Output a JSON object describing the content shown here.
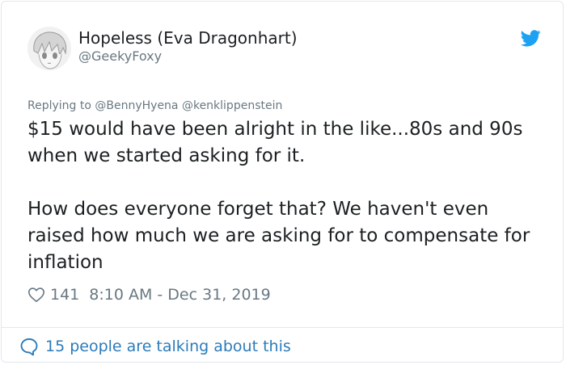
{
  "author": {
    "display_name": "Hopeless (Eva Dragonhart)",
    "handle": "@GeekyFoxy",
    "avatar_icon": "anime-avatar-icon"
  },
  "reply": {
    "label": "Replying to @BennyHyena @kenklippenstein"
  },
  "tweet": {
    "paragraph_1": "$15 would have been alright in the like...80s and 90s when we started asking for it.",
    "paragraph_2": "How does everyone forget that? We haven't even raised how much we are asking for to compensate for inflation"
  },
  "meta": {
    "like_count": "141",
    "timestamp": "8:10 AM - Dec 31, 2019"
  },
  "footer": {
    "talking_label": "15 people are talking about this"
  },
  "colors": {
    "twitter_blue": "#1da1f2",
    "link_blue": "#2b7bb9",
    "secondary_text": "#697882",
    "border": "#e1e8ed"
  }
}
